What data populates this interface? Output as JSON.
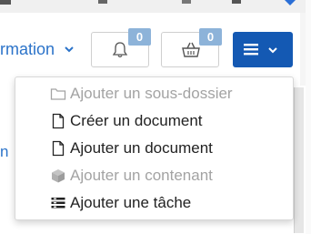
{
  "header": {
    "nav_label": "rmation",
    "notifications_count": "0",
    "basket_count": "0"
  },
  "page": {
    "side_char": "n"
  },
  "dropdown": {
    "items": [
      {
        "label": "Ajouter un sous-dossier",
        "icon": "folder-icon",
        "disabled": true
      },
      {
        "label": "Créer un document",
        "icon": "document-icon",
        "disabled": false
      },
      {
        "label": "Ajouter un document",
        "icon": "document-icon",
        "disabled": false
      },
      {
        "label": "Ajouter un contenant",
        "icon": "box-icon",
        "disabled": true
      },
      {
        "label": "Ajouter une tâche",
        "icon": "task-icon",
        "disabled": false
      }
    ]
  },
  "colors": {
    "accent": "#1459b3",
    "link": "#2b73c9",
    "badge": "#8db3d9",
    "disabled_text": "#a3a3a3"
  }
}
